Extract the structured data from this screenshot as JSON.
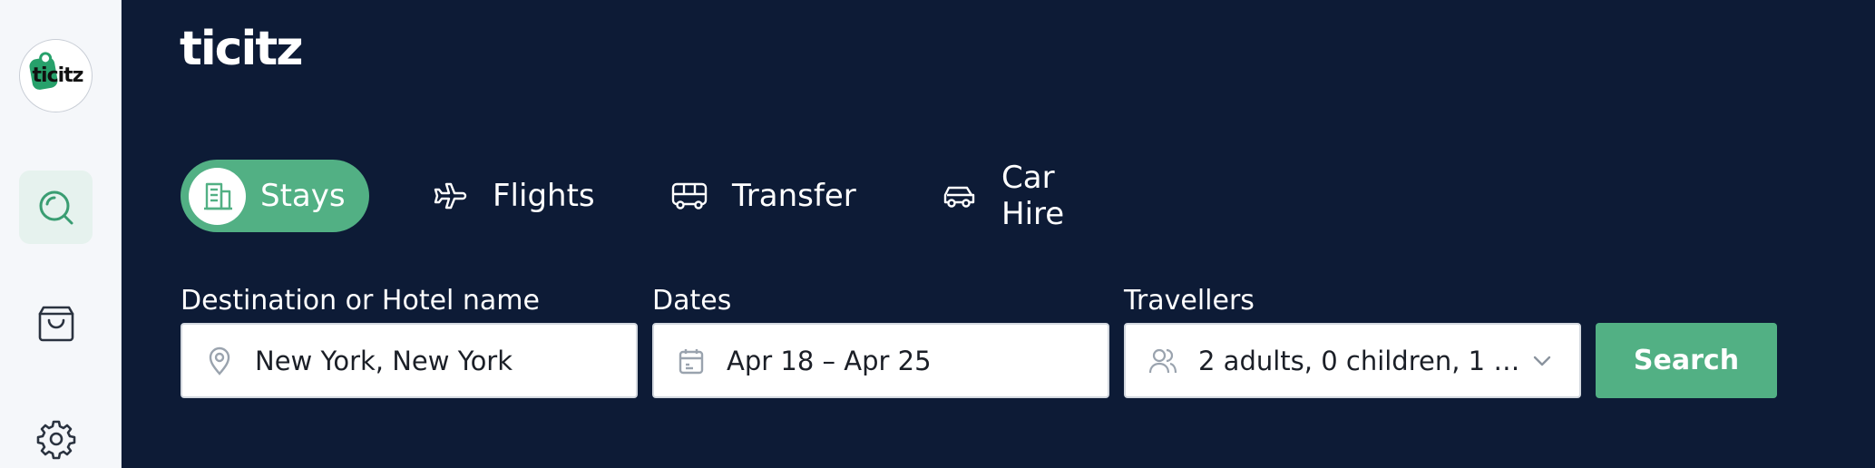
{
  "sidebar": {
    "logo_text": "ticitz",
    "items": [
      {
        "name": "search",
        "icon": "search-icon",
        "active": true
      },
      {
        "name": "bag",
        "icon": "shopping-bag-icon",
        "active": false
      },
      {
        "name": "settings",
        "icon": "gear-icon",
        "active": false
      }
    ]
  },
  "brand": "ticitz",
  "tabs": [
    {
      "label": "Stays",
      "icon": "hotel-icon",
      "active": true
    },
    {
      "label": "Flights",
      "icon": "plane-icon",
      "active": false
    },
    {
      "label": "Transfer",
      "icon": "bus-icon",
      "active": false
    },
    {
      "label": "Car Hire",
      "icon": "car-icon",
      "active": false
    }
  ],
  "form": {
    "destination": {
      "label": "Destination or Hotel name",
      "value": "New York, New York",
      "icon": "location-pin-icon"
    },
    "dates": {
      "label": "Dates",
      "value": "Apr 18 – Apr 25",
      "icon": "calendar-icon"
    },
    "travellers": {
      "label": "Travellers",
      "value": "2 adults, 0 children, 1 ro...",
      "icon": "people-icon"
    },
    "search_label": "Search"
  },
  "colors": {
    "background": "#0d1b36",
    "accent": "#52b084",
    "sidebar": "#f5f7fa",
    "brand_green": "#27a16b"
  }
}
